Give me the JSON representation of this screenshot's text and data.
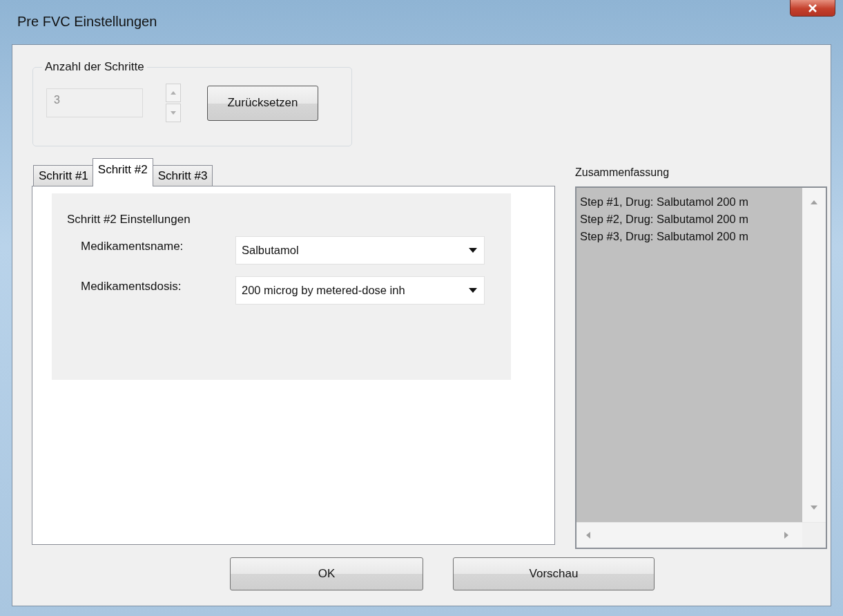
{
  "window": {
    "title": "Pre FVC Einstellungen"
  },
  "steps_group": {
    "label": "Anzahl der Schritte",
    "count": {
      "value": "3",
      "disabled": true
    },
    "reset_button": "Zurücksetzen"
  },
  "tabs": [
    {
      "label": "Schritt #1",
      "selected": false
    },
    {
      "label": "Schritt #2",
      "selected": true
    },
    {
      "label": "Schritt #3",
      "selected": false
    }
  ],
  "step_panel": {
    "heading": "Schritt #2 Einstellungen",
    "fields": [
      {
        "label": "Medikamentsname:",
        "value": "Salbutamol"
      },
      {
        "label": "Medikamentsdosis:",
        "value": "200 microg by metered-dose inh"
      }
    ]
  },
  "summary": {
    "label": "Zusammenfassung",
    "lines": [
      "Step #1, Drug: Salbutamol 200 m",
      "Step #2, Drug: Salbutamol 200 m",
      "Step #3, Drug: Salbutamol 200 m"
    ]
  },
  "buttons": [
    "OK",
    "Vorschau"
  ]
}
